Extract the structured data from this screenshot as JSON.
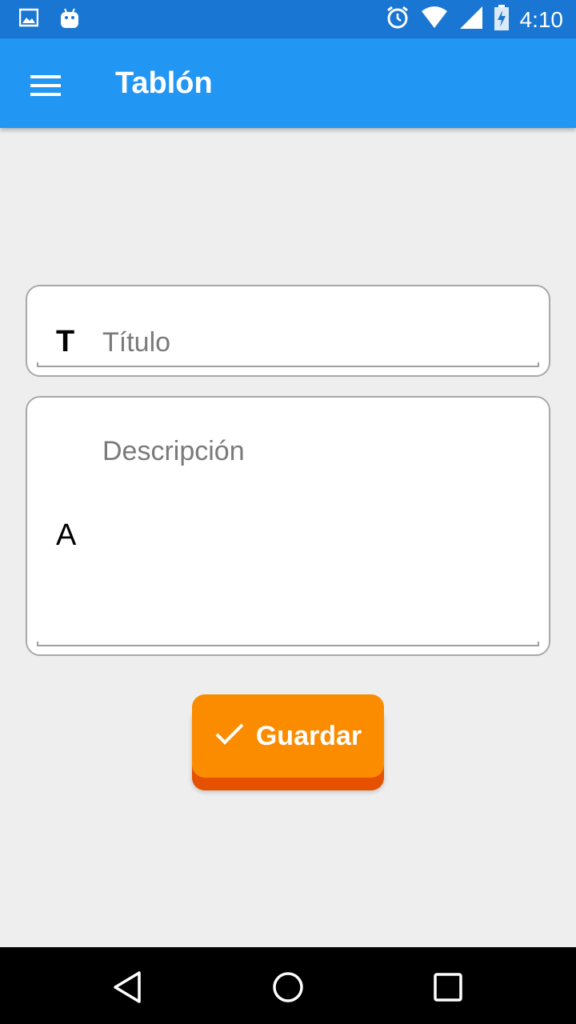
{
  "status_bar": {
    "time": "4:10",
    "left_icons": [
      "image-icon",
      "android-icon"
    ],
    "right_icons": [
      "alarm-icon",
      "wifi-icon",
      "signal-icon",
      "battery-charging-icon"
    ]
  },
  "app_bar": {
    "title": "Tablón",
    "menu_icon": "menu-icon",
    "color": "#2196f3"
  },
  "form": {
    "title_field": {
      "icon_label": "T",
      "placeholder": "Título",
      "value": ""
    },
    "description_field": {
      "icon_label": "A",
      "placeholder": "Descripción",
      "value": ""
    }
  },
  "save_button": {
    "label": "Guardar",
    "icon": "check-icon",
    "color": "#fb8c00"
  },
  "nav_bar": {
    "buttons": [
      "back-icon",
      "home-icon",
      "recents-icon"
    ]
  }
}
